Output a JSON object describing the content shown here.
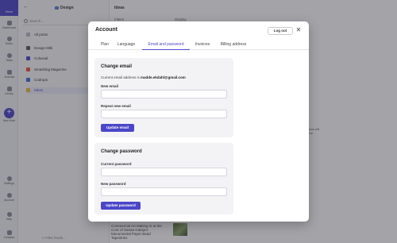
{
  "rail": {
    "home": "Home",
    "items": [
      "Dashboard",
      "Notes",
      "Tasks",
      "Journals",
      "Library"
    ],
    "new_note": "New Note",
    "bottom": [
      "Settings",
      "Account",
      "Help",
      "Collapse"
    ]
  },
  "library": {
    "title": "Design",
    "search_placeholder": "Search...",
    "items": [
      "All posts",
      "Design Milk",
      "Colossal",
      "Smashing Magazine",
      "Codrops",
      "Ideas"
    ],
    "filter_label": "Filter feeds..."
  },
  "feed": {
    "title": "Ideas",
    "filters": "Filters",
    "display": "Display",
    "snippet": "Commercial Art Making Is at the Core of Sanaa Gateja's Monumental Paper Bead Tapestries",
    "side_text": "ideas will\nhere."
  },
  "modal": {
    "title": "Account",
    "logout_label": "Log out",
    "close_icon": "close-icon",
    "tabs": [
      "Plan",
      "Language",
      "Email and password",
      "Invoices",
      "Billing address"
    ],
    "active_tab": "Email and password",
    "email": {
      "title": "Change email",
      "current_prefix": "Current email address is",
      "current_email": "madde.ekdahl@gmail.com",
      "new_label": "New email",
      "new_value": "",
      "repeat_label": "Repeat new email",
      "repeat_value": "",
      "button": "Update email"
    },
    "password": {
      "title": "Change password",
      "current_label": "Current password",
      "current_value": "",
      "new_label": "New password",
      "new_value": "",
      "button": "Update password"
    }
  },
  "colors": {
    "accent": "#4b46c8",
    "panel_bg": "#f3f3f6",
    "overlay": "rgba(40,40,50,0.42)"
  }
}
